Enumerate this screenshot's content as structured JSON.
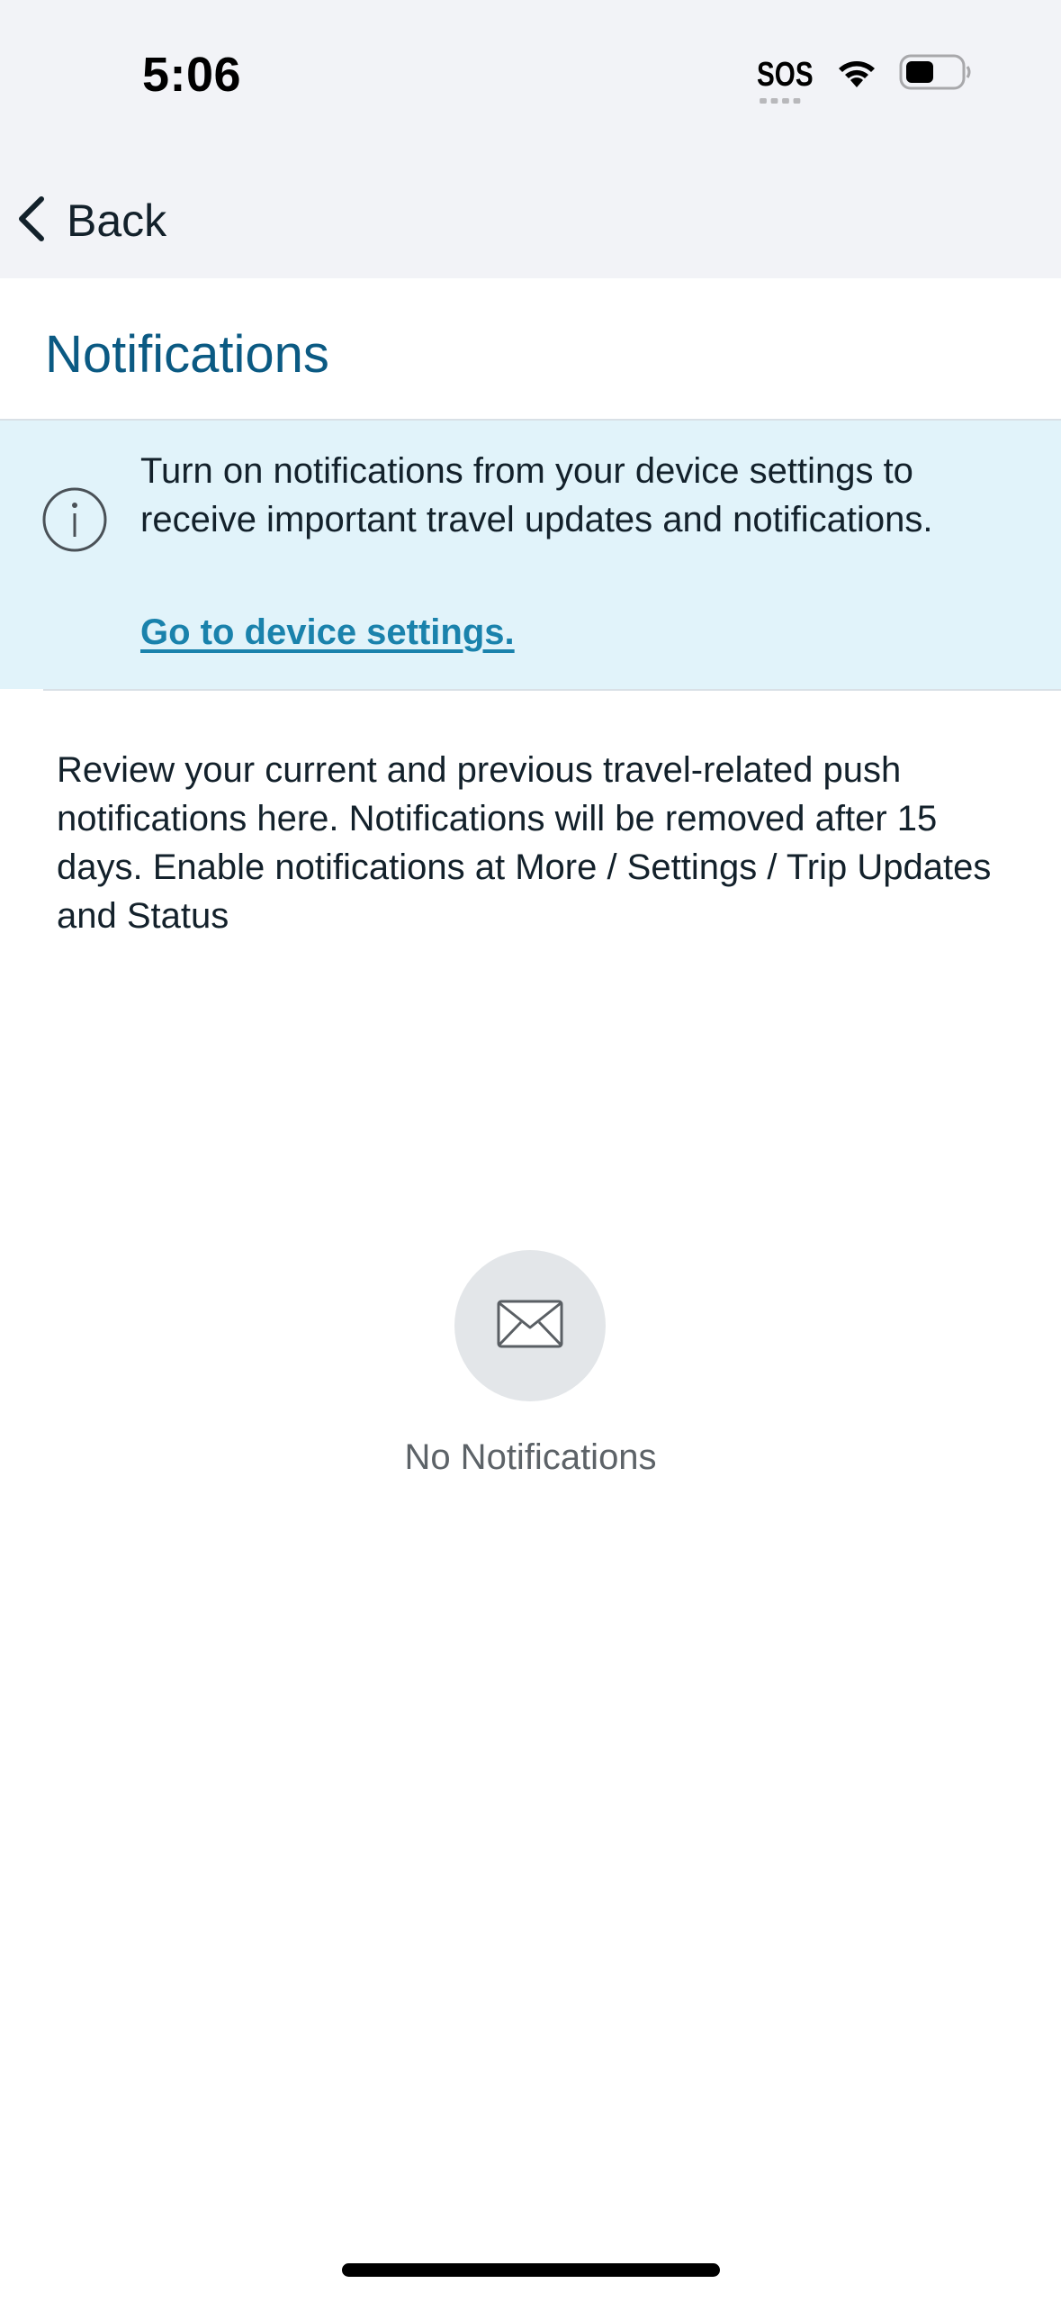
{
  "status_bar": {
    "time": "5:06",
    "sos": "SOS",
    "icons": [
      "sos-indicator",
      "wifi-icon",
      "battery-icon"
    ]
  },
  "nav": {
    "back_label": "Back",
    "back_icon": "chevron-left-icon"
  },
  "page": {
    "title": "Notifications"
  },
  "banner": {
    "icon": "info-icon",
    "text": "Turn on notifications from your device settings to receive important travel updates and notifications.",
    "link_label": "Go to device settings."
  },
  "description": "Review your current and previous travel-related push notifications here. Notifications will be removed after 15 days. Enable notifications at More / Settings / Trip Updates and Status",
  "empty_state": {
    "icon": "envelope-icon",
    "label": "No Notifications"
  },
  "colors": {
    "title": "#0b5a83",
    "link": "#1a82ac",
    "banner_bg": "#e1f3fa",
    "header_bg": "#f2f3f7"
  }
}
